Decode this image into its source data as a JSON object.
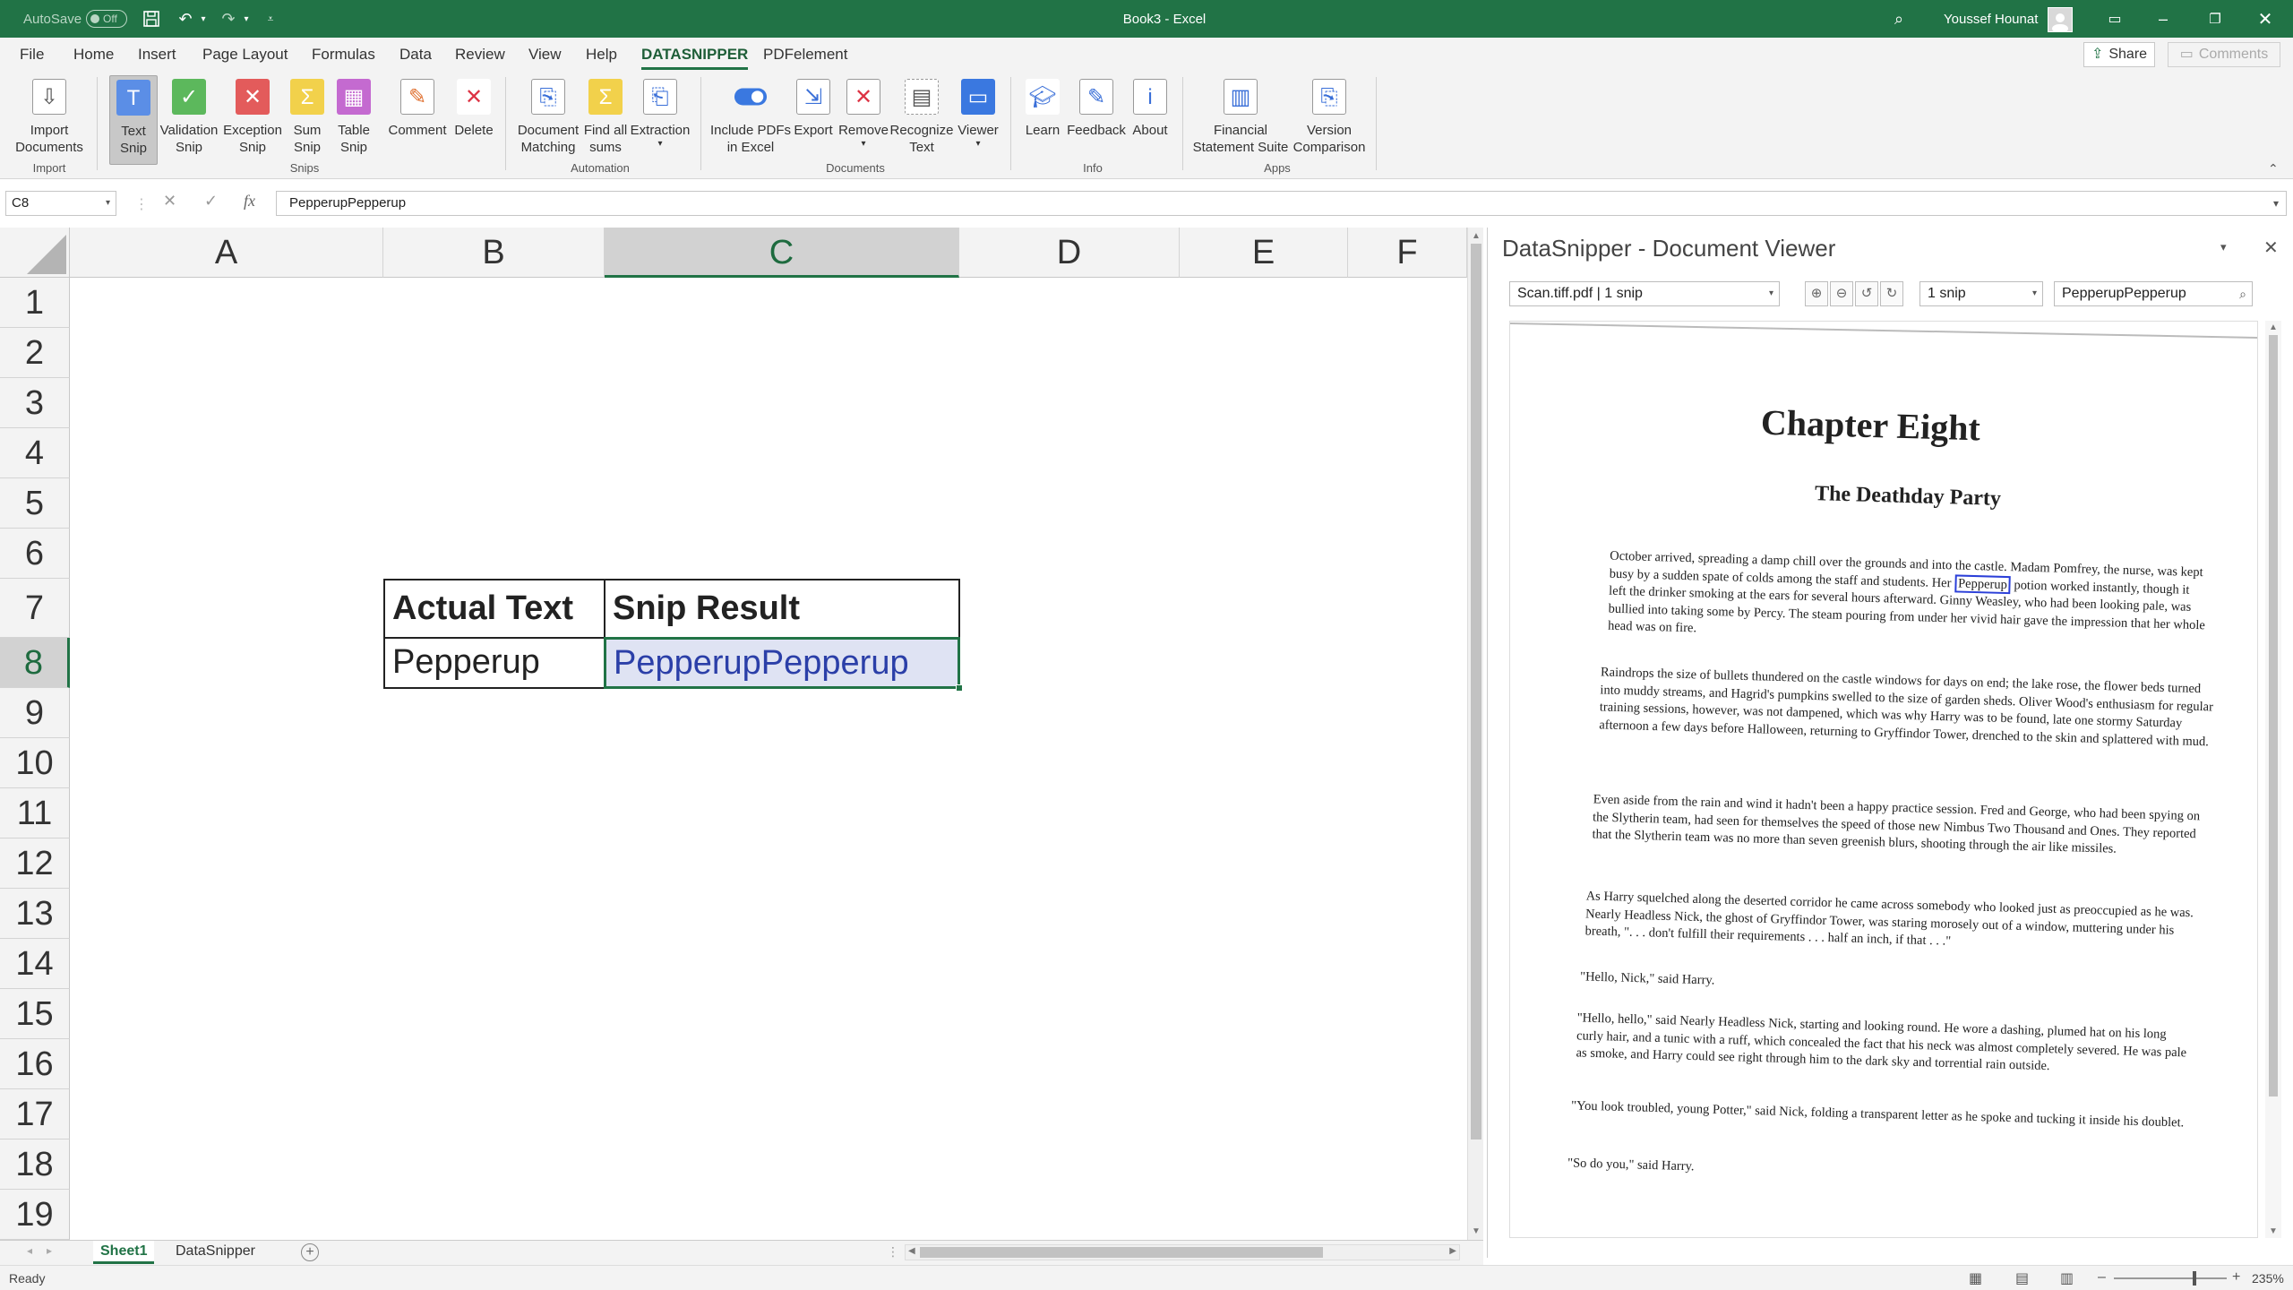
{
  "title_bar": {
    "autosave_label": "AutoSave",
    "autosave_state": "Off",
    "window_title": "Book3  -  Excel",
    "user_name": "Youssef Hounat"
  },
  "menu_tabs": [
    "File",
    "Home",
    "Insert",
    "Page Layout",
    "Formulas",
    "Data",
    "Review",
    "View",
    "Help",
    "DATASNIPPER",
    "PDFelement"
  ],
  "share_label": "Share",
  "comments_label": "Comments",
  "ribbon": {
    "buttons": [
      {
        "label": "Import\nDocuments",
        "icon": "import-documents-icon"
      },
      {
        "label": "Text\nSnip",
        "icon": "text-snip-icon"
      },
      {
        "label": "Validation\nSnip",
        "icon": "validation-snip-icon"
      },
      {
        "label": "Exception\nSnip",
        "icon": "exception-snip-icon"
      },
      {
        "label": "Sum\nSnip",
        "icon": "sum-snip-icon"
      },
      {
        "label": "Table\nSnip",
        "icon": "table-snip-icon"
      },
      {
        "label": "Comment",
        "icon": "comment-icon"
      },
      {
        "label": "Delete",
        "icon": "delete-icon"
      },
      {
        "label": "Document\nMatching",
        "icon": "document-matching-icon"
      },
      {
        "label": "Find all\nsums",
        "icon": "find-all-sums-icon"
      },
      {
        "label": "Extraction",
        "icon": "extraction-icon"
      },
      {
        "label": "Include PDFs\nin Excel",
        "icon": "toggle-icon"
      },
      {
        "label": "Export",
        "icon": "export-icon"
      },
      {
        "label": "Remove",
        "icon": "remove-icon"
      },
      {
        "label": "Recognize\nText",
        "icon": "recognize-text-icon"
      },
      {
        "label": "Viewer",
        "icon": "viewer-icon"
      },
      {
        "label": "Learn",
        "icon": "learn-icon"
      },
      {
        "label": "Feedback",
        "icon": "feedback-icon"
      },
      {
        "label": "About",
        "icon": "about-icon"
      },
      {
        "label": "Financial\nStatement Suite",
        "icon": "financial-statement-icon"
      },
      {
        "label": "Version\nComparison",
        "icon": "version-comparison-icon"
      }
    ],
    "groups": [
      "Import",
      "Snips",
      "Automation",
      "Documents",
      "Info",
      "Apps"
    ]
  },
  "formula_bar": {
    "cell_ref": "C8",
    "content": "PepperupPepperup",
    "fx_label": "fx"
  },
  "grid": {
    "columns": [
      "A",
      "B",
      "C",
      "D",
      "E",
      "F"
    ],
    "rows": [
      "1",
      "2",
      "3",
      "4",
      "5",
      "6",
      "7",
      "8",
      "9",
      "10",
      "11",
      "12",
      "13",
      "14",
      "15",
      "16",
      "17",
      "18",
      "19"
    ],
    "selected_column": "C",
    "selected_row": "8",
    "cells": {
      "B7": "Actual Text",
      "C7": "Snip Result",
      "B8": "Pepperup",
      "C8": "PepperupPepperup"
    }
  },
  "document_viewer": {
    "title": "DataSnipper - Document Viewer",
    "document_select": "Scan.tiff.pdf | 1 snip",
    "snip_select": "1 snip",
    "search_value": "PepperupPepperup",
    "page": {
      "heading": "Chapter Eight",
      "subheading": "The Deathday Party",
      "highlight_word": "Pepperup",
      "paragraphs": [
        "October arrived, spreading a damp chill over the grounds and into the castle. Madam Pomfrey, the nurse, was kept busy by a sudden spate of colds among the staff and students. Her",
        "potion worked instantly, though it left the drinker smoking at the ears for several hours afterward. Ginny Weasley, who had been looking pale, was bullied into taking some by Percy. The steam pouring from under her vivid hair gave the impression that her whole head was on fire.",
        "Raindrops the size of bullets thundered on the castle windows for days on end; the lake rose, the flower beds turned into muddy streams, and Hagrid's pumpkins swelled to the size of garden sheds. Oliver Wood's enthusiasm for regular training sessions, however, was not dampened, which was why Harry was to be found, late one stormy Saturday afternoon a few days before Halloween, returning to Gryffindor Tower, drenched to the skin and splattered with mud.",
        "Even aside from the rain and wind it hadn't been a happy practice session. Fred and George, who had been spying on the Slytherin team, had seen for themselves the speed of those new Nimbus Two Thousand and Ones. They reported that the Slytherin team was no more than seven greenish blurs, shooting through the air like missiles.",
        "As Harry squelched along the deserted corridor he came across somebody who looked just as preoccupied as he was. Nearly Headless Nick, the ghost of Gryffindor Tower, was staring morosely out of a window, muttering under his breath, \". . . don't fulfill their requirements . . . half an inch, if that . . .\"",
        "\"Hello, Nick,\" said Harry.",
        "\"Hello, hello,\" said Nearly Headless Nick, starting and looking round. He wore a dashing, plumed hat on his long curly hair, and a tunic with a ruff, which concealed the fact that his neck was almost completely severed. He was pale as smoke, and Harry could see right through him to the dark sky and torrential rain outside.",
        "\"You look troubled, young Potter,\" said Nick, folding a transparent letter as he spoke and tucking it inside his doublet.",
        "\"So do you,\" said Harry."
      ]
    }
  },
  "sheet_tabs": [
    "Sheet1",
    "DataSnipper"
  ],
  "active_sheet": "Sheet1",
  "status": {
    "ready": "Ready",
    "zoom": "235%"
  },
  "colors": {
    "excel_green": "#217346",
    "selection_fill": "#dfe3f3",
    "snip_box": "#2b3fd8"
  }
}
